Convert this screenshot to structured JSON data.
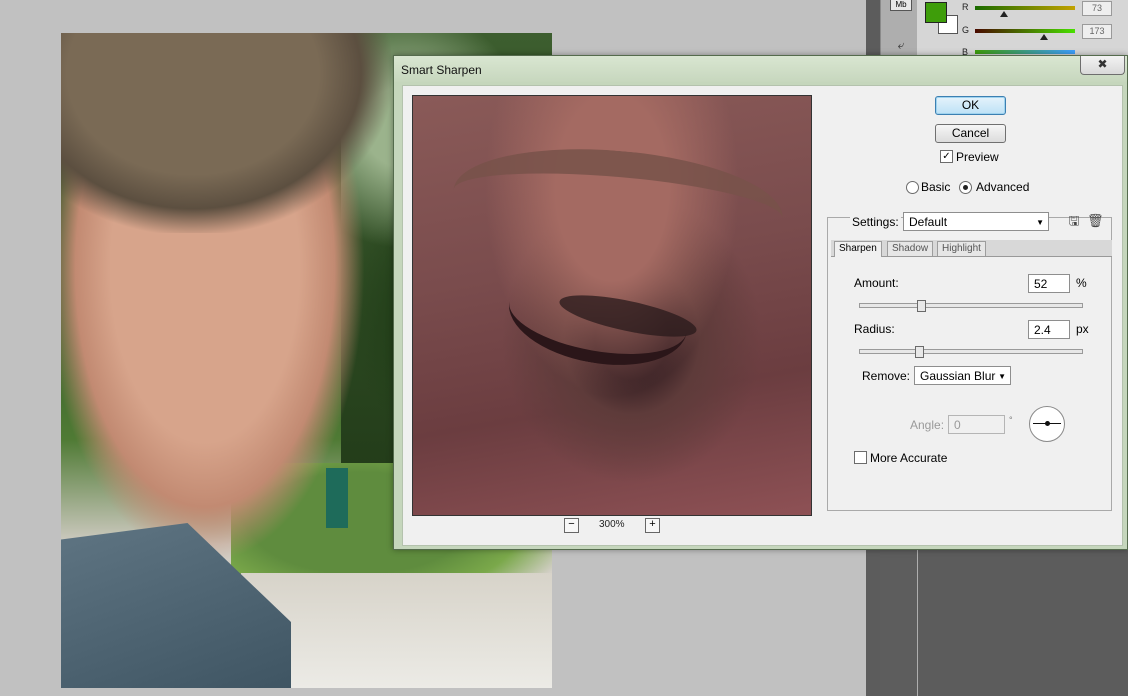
{
  "dialog": {
    "title": "Smart Sharpen",
    "close_glyph": "✖",
    "ok_label": "OK",
    "cancel_label": "Cancel",
    "preview_label": "Preview",
    "preview_checked": true,
    "mode_basic_label": "Basic",
    "mode_advanced_label": "Advanced",
    "mode_selected": "Advanced",
    "settings_label": "Settings:",
    "settings_value": "Default",
    "tabs": [
      "Sharpen",
      "Shadow",
      "Highlight"
    ],
    "active_tab": "Sharpen",
    "amount_label": "Amount:",
    "amount_value": "52",
    "amount_unit": "%",
    "radius_label": "Radius:",
    "radius_value": "2.4",
    "radius_unit": "px",
    "remove_label": "Remove:",
    "remove_value": "Gaussian Blur",
    "angle_label": "Angle:",
    "angle_value": "0",
    "angle_unit": "°",
    "more_accurate_label": "More Accurate",
    "more_accurate_checked": false,
    "zoom_out_glyph": "−",
    "zoom_in_glyph": "+",
    "zoom_level": "300%"
  },
  "color_panel": {
    "mb_label": "Mb",
    "r_label": "R",
    "g_label": "G",
    "b_label": "B",
    "r_value": "73",
    "g_value": "173",
    "foreground_color": "#3e9d0a",
    "background_color": "#ffffff"
  },
  "icons": {
    "save_settings": "🖫",
    "delete_settings": "🗑",
    "history": "⤶",
    "checkmark": "✓"
  }
}
